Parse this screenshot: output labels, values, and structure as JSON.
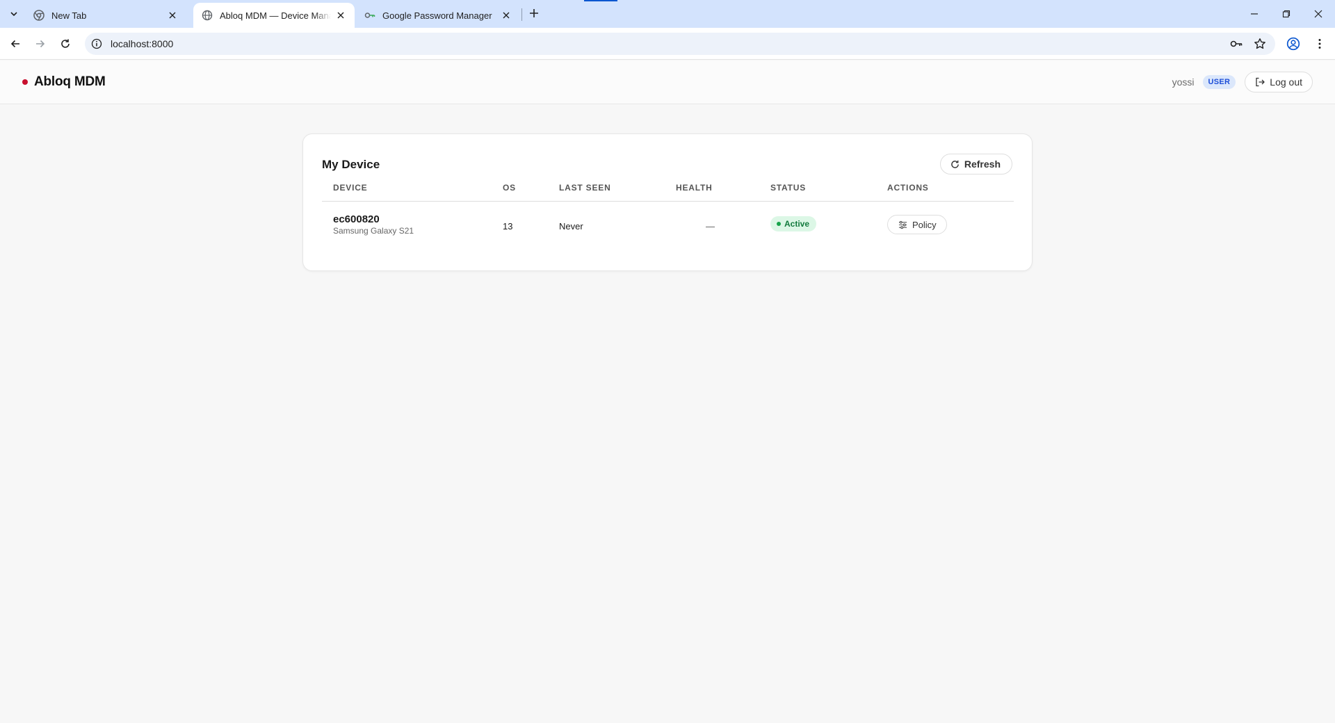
{
  "browser": {
    "tabs": [
      {
        "title": "New Tab",
        "favicon": "chrome-icon"
      },
      {
        "title": "Abloq MDM — Device Management",
        "favicon": "globe-icon"
      },
      {
        "title": "Google Password Manager",
        "favicon": "key-icon"
      }
    ],
    "url": "localhost:8000"
  },
  "header": {
    "brand": "Abloq MDM",
    "brand_dot_color": "#c8102e",
    "username": "yossi",
    "role": "USER",
    "logout_label": "Log out"
  },
  "card": {
    "title": "My Device",
    "refresh_label": "Refresh",
    "columns": [
      "DEVICE",
      "OS",
      "LAST SEEN",
      "HEALTH",
      "STATUS",
      "ACTIONS"
    ],
    "rows": [
      {
        "device_id": "ec600820",
        "model": "Samsung Galaxy S21",
        "os": "13",
        "last_seen": "Never",
        "health": "—",
        "status": "Active",
        "action_label": "Policy"
      }
    ]
  },
  "colors": {
    "status_active_bg": "#dcf7e6",
    "status_active_text": "#127a3d",
    "role_badge_bg": "#dbe7fb",
    "role_badge_text": "#1d4ed8"
  }
}
